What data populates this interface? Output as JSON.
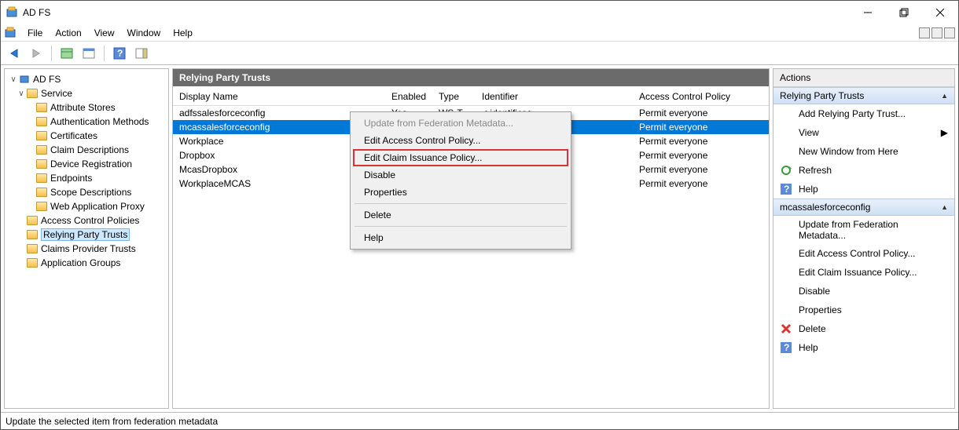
{
  "window": {
    "title": "AD FS"
  },
  "menus": [
    "File",
    "Action",
    "View",
    "Window",
    "Help"
  ],
  "tree": {
    "root": "AD FS",
    "service": "Service",
    "items": [
      "Attribute Stores",
      "Authentication Methods",
      "Certificates",
      "Claim Descriptions",
      "Device Registration",
      "Endpoints",
      "Scope Descriptions",
      "Web Application Proxy"
    ],
    "bottom": [
      "Access Control Policies",
      "Relying Party Trusts",
      "Claims Provider Trusts",
      "Application Groups"
    ],
    "selected_index": 1
  },
  "center": {
    "title": "Relying Party Trusts",
    "cols": {
      "dn": "Display Name",
      "en": "Enabled",
      "ty": "Type",
      "id": "Identifier",
      "acp": "Access Control Policy"
    },
    "rows": [
      {
        "dn": "adfssalesforceconfig",
        "en": "Yes",
        "ty": "WS-T...",
        "id": "< identifier >",
        "acp": "Permit everyone"
      },
      {
        "dn": "mcassalesforceconfig",
        "en": "",
        "ty": "",
        "id": "",
        "acp": "Permit everyone"
      },
      {
        "dn": "Workplace",
        "en": "",
        "ty": "",
        "id": "",
        "acp": "Permit everyone"
      },
      {
        "dn": "Dropbox",
        "en": "",
        "ty": "",
        "id": "",
        "acp": "Permit everyone"
      },
      {
        "dn": "McasDropbox",
        "en": "",
        "ty": "",
        "id": "",
        "acp": "Permit everyone"
      },
      {
        "dn": "WorkplaceMCAS",
        "en": "",
        "ty": "",
        "id": "",
        "acp": "Permit everyone"
      }
    ],
    "selected_row": 1
  },
  "context_menu": {
    "items": [
      {
        "label": "Update from Federation Metadata...",
        "disabled": true
      },
      {
        "label": "Edit Access Control Policy..."
      },
      {
        "label": "Edit Claim Issuance Policy...",
        "highlight": true
      },
      {
        "label": "Disable"
      },
      {
        "label": "Properties"
      },
      {
        "sep": true
      },
      {
        "label": "Delete"
      },
      {
        "sep": true
      },
      {
        "label": "Help"
      }
    ]
  },
  "actions": {
    "title": "Actions",
    "group1": "Relying Party Trusts",
    "g1_items": [
      {
        "label": "Add Relying Party Trust..."
      },
      {
        "label": "View",
        "arrow": true
      },
      {
        "label": "New Window from Here"
      },
      {
        "label": "Refresh",
        "icon": "refresh"
      },
      {
        "label": "Help",
        "icon": "help"
      }
    ],
    "group2": "mcassalesforceconfig",
    "g2_items": [
      {
        "label": "Update from Federation Metadata..."
      },
      {
        "label": "Edit Access Control Policy..."
      },
      {
        "label": "Edit Claim Issuance Policy..."
      },
      {
        "label": "Disable"
      },
      {
        "label": "Properties"
      },
      {
        "label": "Delete",
        "icon": "delete"
      },
      {
        "label": "Help",
        "icon": "help"
      }
    ]
  },
  "status": "Update the selected item from federation metadata"
}
